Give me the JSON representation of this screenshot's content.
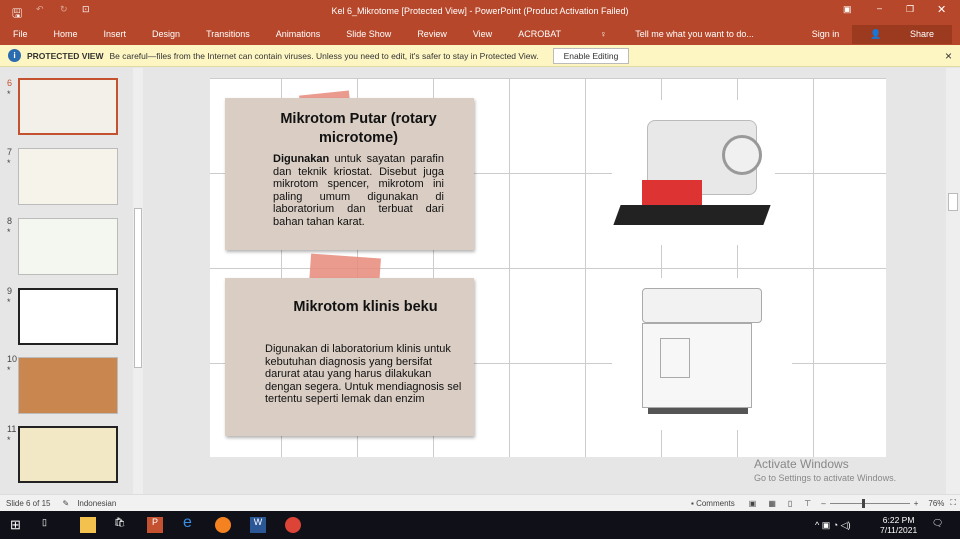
{
  "titlebar": {
    "title": "Kel 6_Mikrotome [Protected View] - PowerPoint (Product Activation Failed)"
  },
  "ribbon": {
    "tabs": [
      "File",
      "Home",
      "Insert",
      "Design",
      "Transitions",
      "Animations",
      "Slide Show",
      "Review",
      "View",
      "ACROBAT"
    ],
    "tell_me": "Tell me what you want to do...",
    "sign_in": "Sign in",
    "share": "Share"
  },
  "protected": {
    "label": "PROTECTED VIEW",
    "message": "Be careful—files from the Internet can contain viruses. Unless you need to edit, it's safer to stay in Protected View.",
    "button": "Enable Editing",
    "close": "×"
  },
  "thumbnails": [
    {
      "num": "6",
      "star": "*"
    },
    {
      "num": "7",
      "star": "*"
    },
    {
      "num": "8",
      "star": "*"
    },
    {
      "num": "9",
      "star": "*"
    },
    {
      "num": "10",
      "star": "*"
    },
    {
      "num": "11",
      "star": "*"
    }
  ],
  "slide": {
    "card1": {
      "title": "Mikrotom Putar (rotary microtome)",
      "bold": "Digunakan",
      "text": " untuk sayatan parafin dan teknik kriostat. Disebut juga mikrotom spencer, mikrotom ini paling umum digunakan di laboratorium dan terbuat dari bahan tahan karat."
    },
    "card2": {
      "title": "Mikrotom klinis beku",
      "text": "Digunakan di laboratorium klinis untuk kebutuhan diagnosis yang bersifat darurat atau yang harus dilakukan dengan segera. Untuk mendiagnosis sel tertentu seperti lemak dan enzim"
    }
  },
  "watermark": {
    "title": "Activate Windows",
    "sub": "Go to Settings to activate Windows."
  },
  "status": {
    "slide": "Slide 6 of 15",
    "language": "Indonesian",
    "comments": "Comments",
    "zoom": "76%"
  },
  "taskbar": {
    "time": "6:22 PM",
    "date": "7/11/2021"
  }
}
